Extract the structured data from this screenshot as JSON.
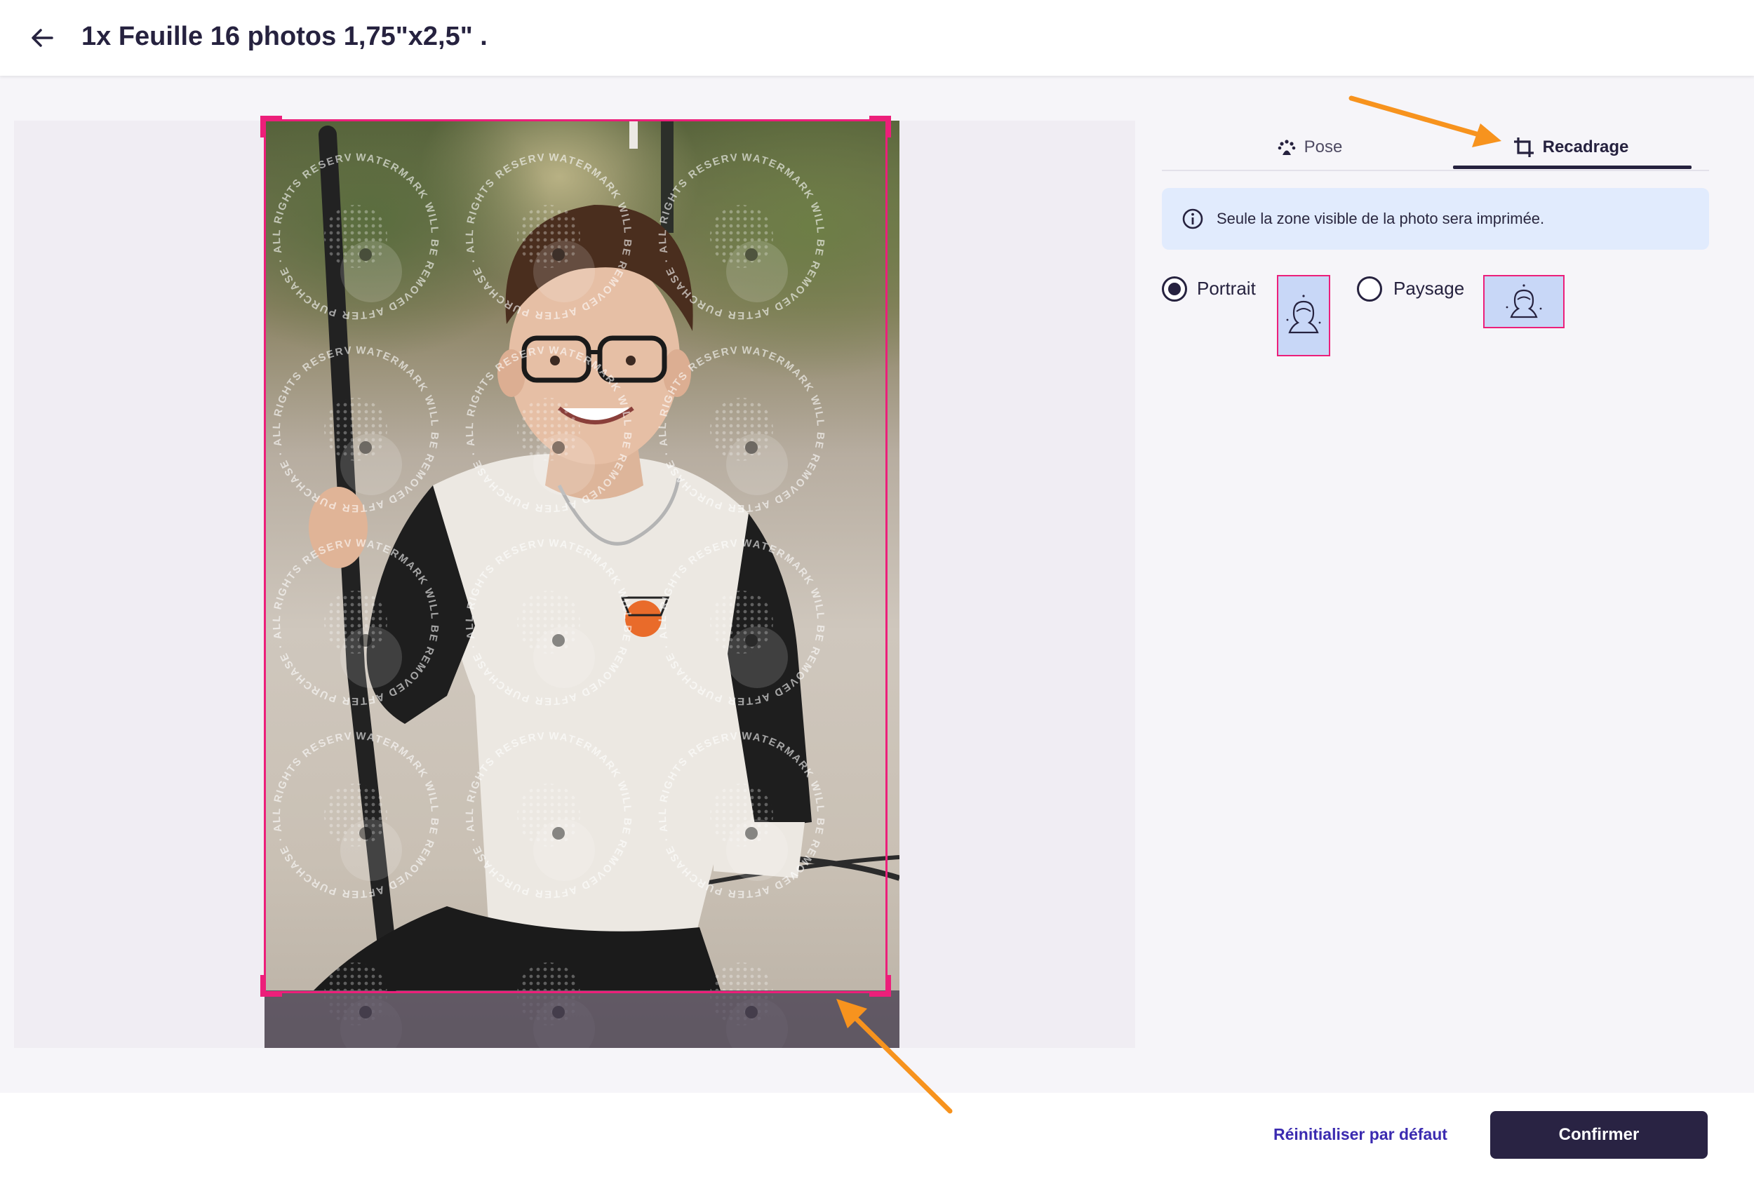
{
  "header": {
    "back_icon": "arrow-left-icon",
    "title": "1x Feuille 16 photos 1,75\"x2,5\" ."
  },
  "editor": {
    "watermark_text": "WATERMARK WILL BE REMOVED AFTER PURCHASE · ALL RIGHTS RESERVED ·",
    "crop_color": "#ec1f7a"
  },
  "tabs": [
    {
      "label": "Pose",
      "icon": "pose-icon",
      "active": false
    },
    {
      "label": "Recadrage",
      "icon": "crop-icon",
      "active": true
    }
  ],
  "info": {
    "icon": "info-icon",
    "text": "Seule la zone visible de la photo sera imprimée."
  },
  "orientation": {
    "options": [
      {
        "label": "Portrait",
        "checked": true,
        "thumb_icon": "portrait-face-icon"
      },
      {
        "label": "Paysage",
        "checked": false,
        "thumb_icon": "landscape-face-icon"
      }
    ]
  },
  "footer": {
    "reset_label": "Réinitialiser par défaut",
    "confirm_label": "Confirmer"
  },
  "colors": {
    "primary": "#292343",
    "accent_pink": "#ec1f7a",
    "annotation_orange": "#f7931e",
    "info_bg": "#e1ebfd",
    "link": "#3b2bb0"
  }
}
